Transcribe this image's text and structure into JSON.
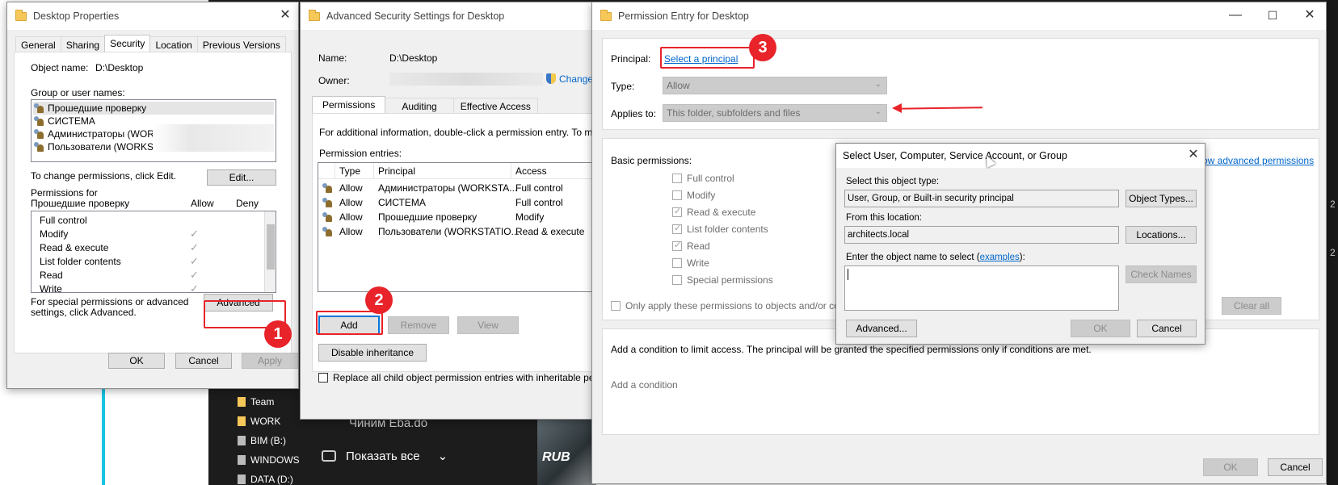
{
  "background": {
    "taskbar_items": [
      "Team",
      "WORK",
      "BIM (B:)",
      "WINDOWS",
      "DATA (D:)"
    ],
    "notification_text": "Чиним Eba.do",
    "show_all": "Показать все",
    "photo_text": "RUB",
    "right_edge_labels": [
      "2",
      "2"
    ]
  },
  "desktop_props": {
    "title": "Desktop Properties",
    "tabs": [
      "General",
      "Sharing",
      "Security",
      "Location",
      "Previous Versions"
    ],
    "object_name_label": "Object name:",
    "object_name_value": "D:\\Desktop",
    "group_label": "Group or user names:",
    "users": [
      "Прошедшие проверку",
      "СИСТЕМА",
      "Администраторы (WORK",
      "Пользователи (WORKST"
    ],
    "change_text": "To change permissions, click Edit.",
    "edit_btn": "Edit...",
    "perms_for": "Permissions for Прошедшие проверку",
    "allow_header": "Allow",
    "deny_header": "Deny",
    "perms": [
      "Full control",
      "Modify",
      "Read & execute",
      "List folder contents",
      "Read",
      "Write"
    ],
    "special_text": "For special permissions or advanced settings, click Advanced.",
    "advanced_btn": "Advanced",
    "ok": "OK",
    "cancel": "Cancel",
    "apply": "Apply"
  },
  "adv_security": {
    "title": "Advanced Security Settings for Desktop",
    "name_label": "Name:",
    "name_value": "D:\\Desktop",
    "owner_label": "Owner:",
    "change_link": "Change",
    "tabs": [
      "Permissions",
      "Auditing",
      "Effective Access"
    ],
    "info_text": "For additional information, double-click a permission entry. To m",
    "entries_label": "Permission entries:",
    "columns": [
      "Type",
      "Principal",
      "Access"
    ],
    "entries": [
      {
        "type": "Allow",
        "principal": "Администраторы (WORKSTA...",
        "access": "Full control"
      },
      {
        "type": "Allow",
        "principal": "СИСТЕМА",
        "access": "Full control"
      },
      {
        "type": "Allow",
        "principal": "Прошедшие проверку",
        "access": "Modify"
      },
      {
        "type": "Allow",
        "principal": "Пользователи (WORKSTATIO...",
        "access": "Read & execute"
      }
    ],
    "add_btn": "Add",
    "remove_btn": "Remove",
    "view_btn": "View",
    "disable_btn": "Disable inheritance",
    "replace_text": "Replace all child object permission entries with inheritable per"
  },
  "perm_entry": {
    "title": "Permission Entry for Desktop",
    "principal_label": "Principal:",
    "select_principal": "Select a principal",
    "type_label": "Type:",
    "type_value": "Allow",
    "applies_label": "Applies to:",
    "applies_value": "This folder, subfolders and files",
    "basic_label": "Basic permissions:",
    "show_adv": "ow advanced permissions",
    "perms": [
      {
        "label": "Full control",
        "checked": false
      },
      {
        "label": "Modify",
        "checked": false
      },
      {
        "label": "Read & execute",
        "checked": true
      },
      {
        "label": "List folder contents",
        "checked": true
      },
      {
        "label": "Read",
        "checked": true
      },
      {
        "label": "Write",
        "checked": false
      },
      {
        "label": "Special permissions",
        "checked": false
      }
    ],
    "only_apply": "Only apply these permissions to objects and/or co",
    "clear_all": "Clear all",
    "condition_text": "Add a condition to limit access. The principal will be granted the specified permissions only if conditions are met.",
    "add_condition": "Add a condition",
    "ok": "OK",
    "cancel": "Cancel"
  },
  "select_user": {
    "title": "Select User, Computer, Service Account, or Group",
    "object_type_label": "Select this object type:",
    "object_type_value": "User, Group, or Built-in security principal",
    "object_types_btn": "Object Types...",
    "location_label": "From this location:",
    "location_value": "architects.local",
    "locations_btn": "Locations...",
    "enter_label_pre": "Enter the object name to select (",
    "examples_link": "examples",
    "enter_label_post": "):",
    "check_names_btn": "Check Names",
    "advanced_btn": "Advanced...",
    "ok": "OK",
    "cancel": "Cancel"
  },
  "annotations": [
    "1",
    "2",
    "3"
  ],
  "colors": {
    "annotation_red": "#e8232a",
    "link_blue": "#0066cc",
    "focus_blue": "#0078d7"
  }
}
